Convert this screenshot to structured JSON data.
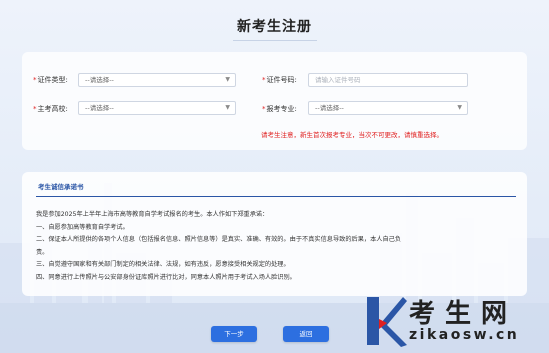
{
  "page": {
    "title": "新考生注册"
  },
  "form": {
    "id_type": {
      "label": "证件类型:",
      "value": "--请选择--"
    },
    "id_number": {
      "label": "证件号码:",
      "placeholder": "请输入证件号码"
    },
    "school": {
      "label": "主考高校:",
      "value": "--请选择--"
    },
    "major": {
      "label": "报考专业:",
      "value": "--请选择--"
    },
    "required_mark": "*",
    "warning": "请考生注意，新生首次报考专业，当次不可更改，请慎重选择。"
  },
  "promise": {
    "heading": "考生诚信承诺书",
    "lines": [
      "我是参加2025年上半年上海市高等教育自学考试报名的考生。本人作如下郑重承诺：",
      "一、自愿参加高等教育自学考试。",
      "二、保证本人所提供的各项个人信息（包括报名信息、照片信息等）是真实、准确、有效的。由于不真实信息导致的后果，本人自己负",
      "责。",
      "三、自觉遵守国家和有关部门制定的相关法律、法规，如有违反，愿意接受相关规定的处理。",
      "四、同意进行上传照片与公安部身份证库照片进行比对，同意本人照片用于考试入场人脸识别。"
    ]
  },
  "buttons": {
    "next": "下一步",
    "back": "返回"
  },
  "watermark": {
    "text": "考生网",
    "url": "zikaosw.cn"
  },
  "colors": {
    "primary": "#2d6fe0",
    "warning": "#e02020",
    "heading": "#2b56a6",
    "watermark_k": "#2b56a6"
  }
}
